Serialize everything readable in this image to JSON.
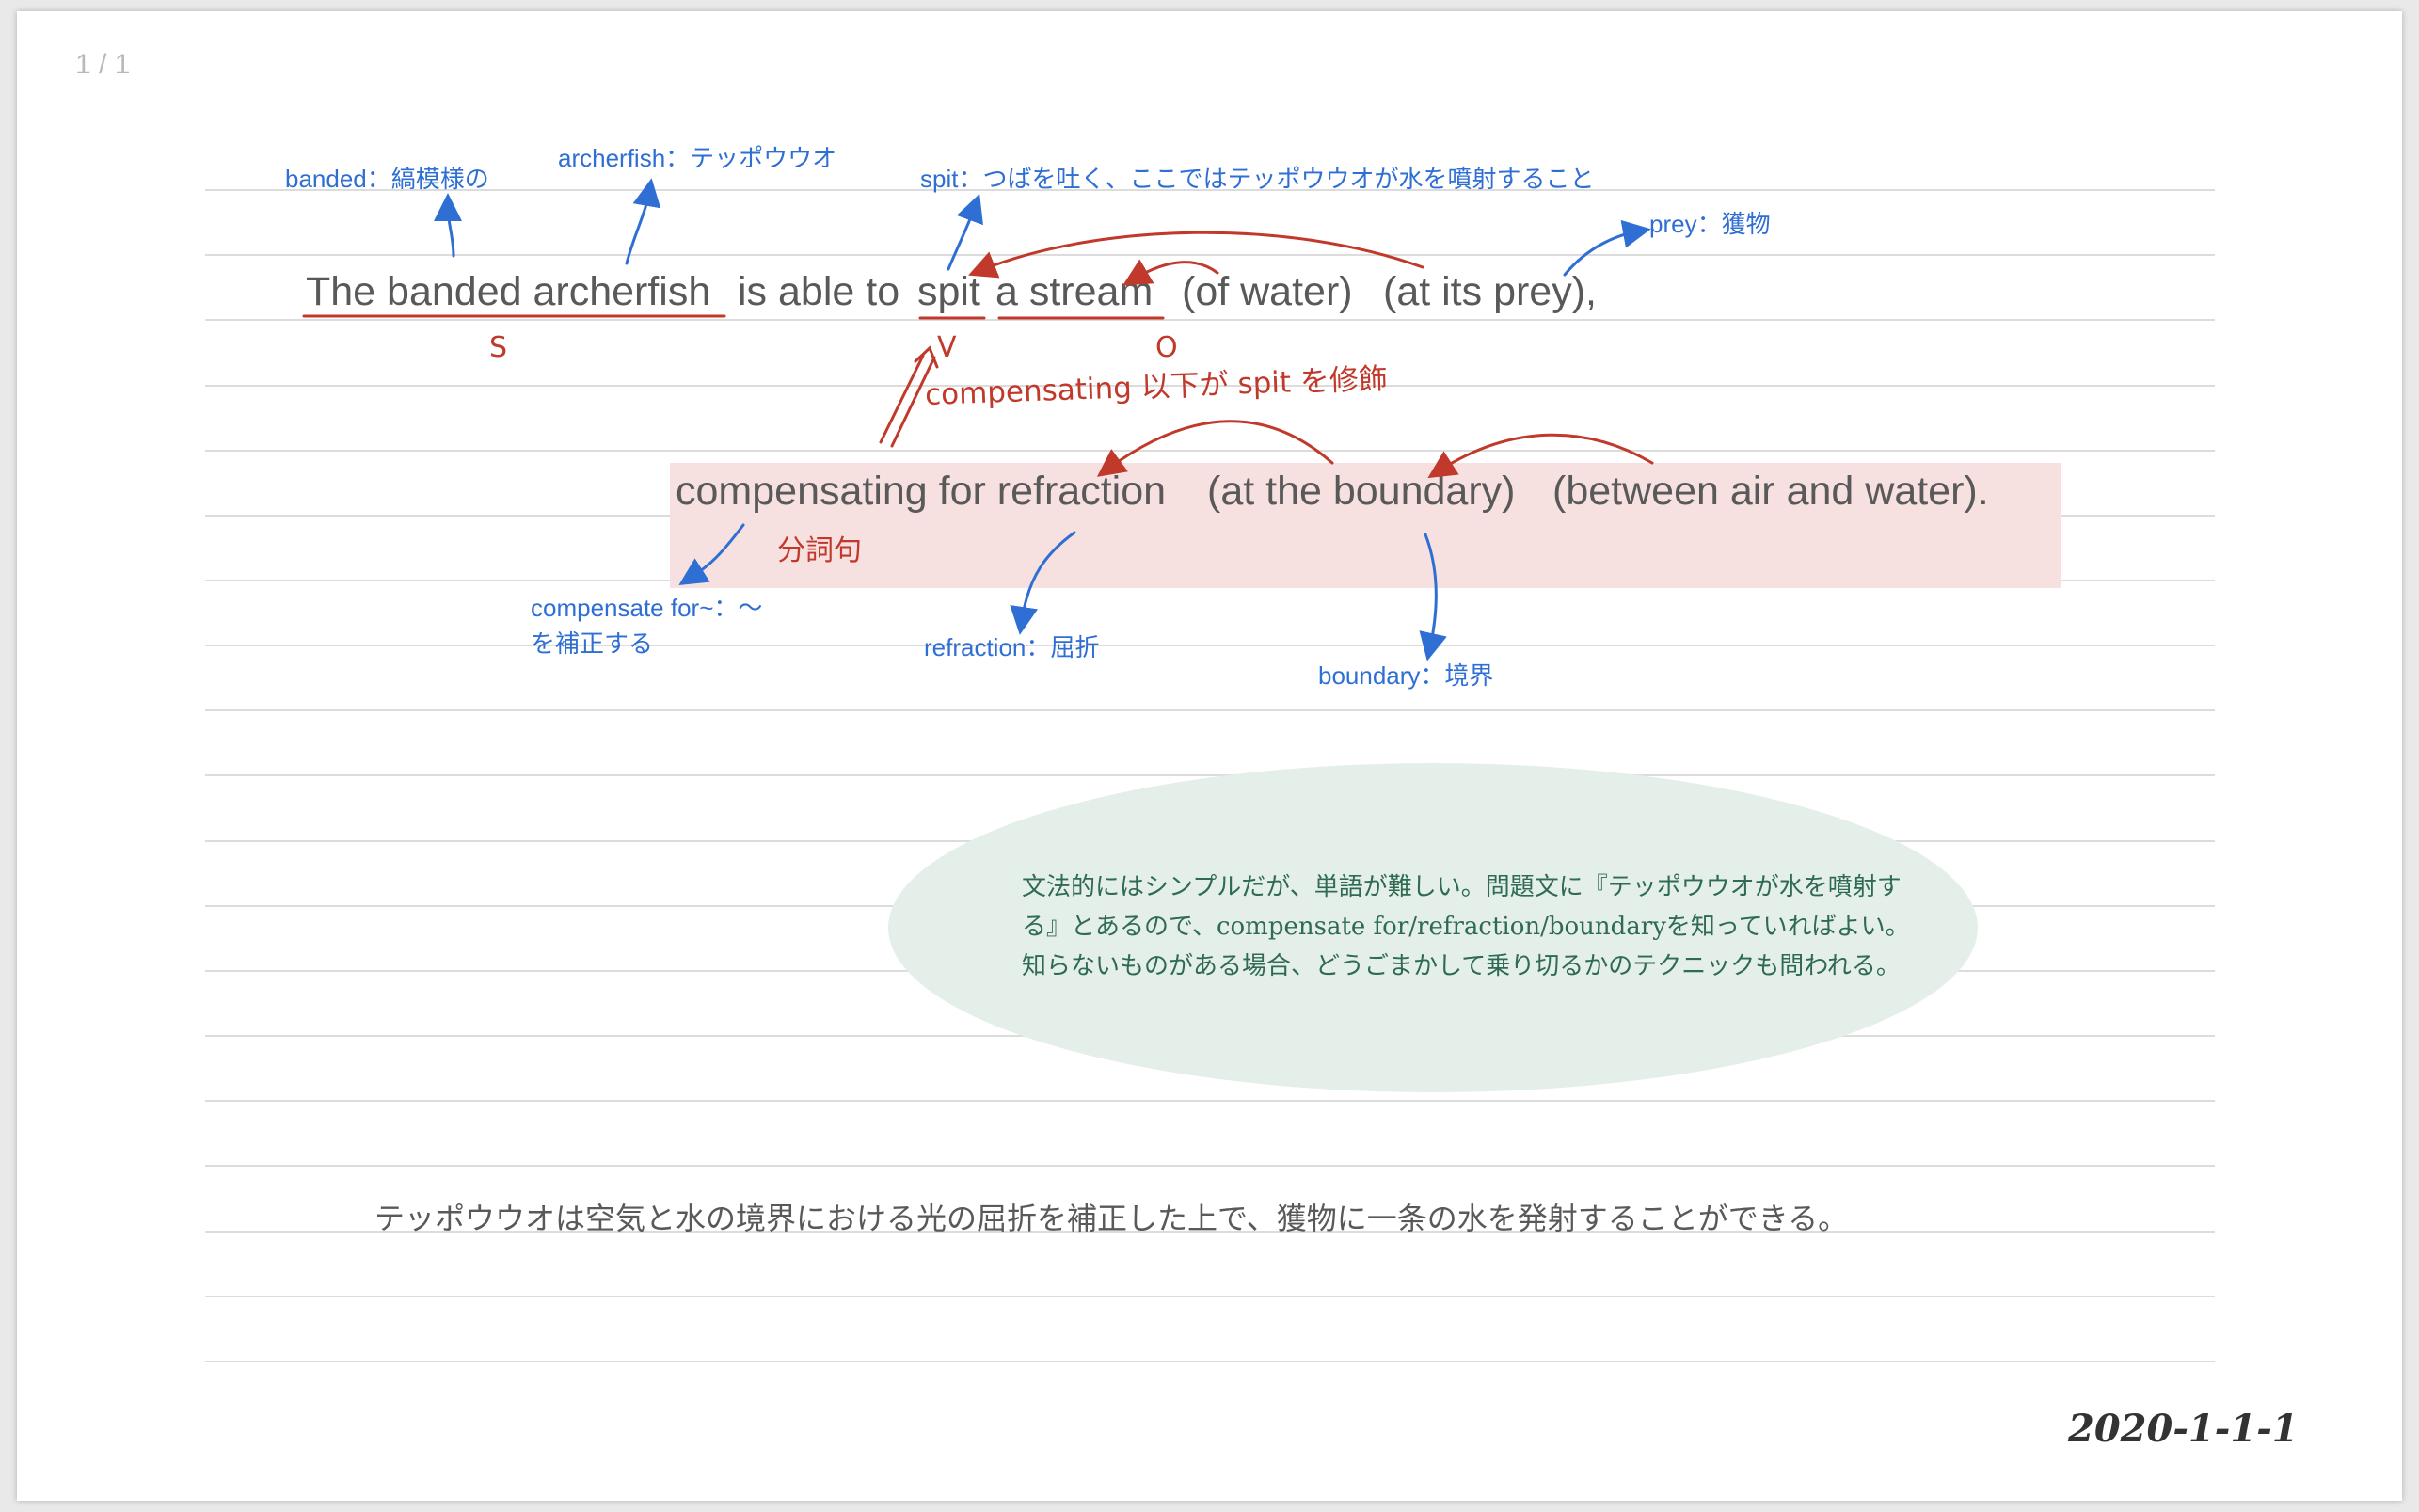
{
  "page_indicator": "1 / 1",
  "colors": {
    "annotation_blue": "#2f6fd4",
    "handwriting_red": "#c0392b",
    "highlight_pink": "#f7e0e0",
    "note_green": "#2e6b52",
    "note_bubble": "#e5efea"
  },
  "vocab": {
    "banded": "banded：縞模様の",
    "archerfish": "archerfish：テッポウウオ",
    "spit": "spit：つばを吐く、ここではテッポウウオが水を噴射すること",
    "prey": "prey：獲物",
    "compensate_line1": "compensate for~：～",
    "compensate_line2": "を補正する",
    "refraction": "refraction：屈折",
    "boundary": "boundary：境界"
  },
  "sentence1": {
    "subject": "The banded archerfish",
    "aux": "is able to",
    "verb": "spit",
    "object": "a stream",
    "phrase1": "(of water)",
    "phrase2": "(at its prey),"
  },
  "sentence2": {
    "main": "compensating for refraction",
    "phrase1": "(at the boundary)",
    "phrase2": "(between air and water)."
  },
  "handwriting": {
    "s_label": "S",
    "v_label": "V",
    "o_label": "O",
    "modifier_note": "compensating 以下が spit を修飾",
    "participle_label": "分詞句"
  },
  "note": "文法的にはシンプルだが、単語が難しい。問題文に『テッポウウオが水を噴射する』とあるので、compensate for/refraction/boundaryを知っていればよい。知らないものがある場合、どうごまかして乗り切るかのテクニックも問われる。",
  "translation": "テッポウウオは空気と水の境界における光の屈折を補正した上で、獲物に一条の水を発射することができる。",
  "date": "2020-1-1-1"
}
